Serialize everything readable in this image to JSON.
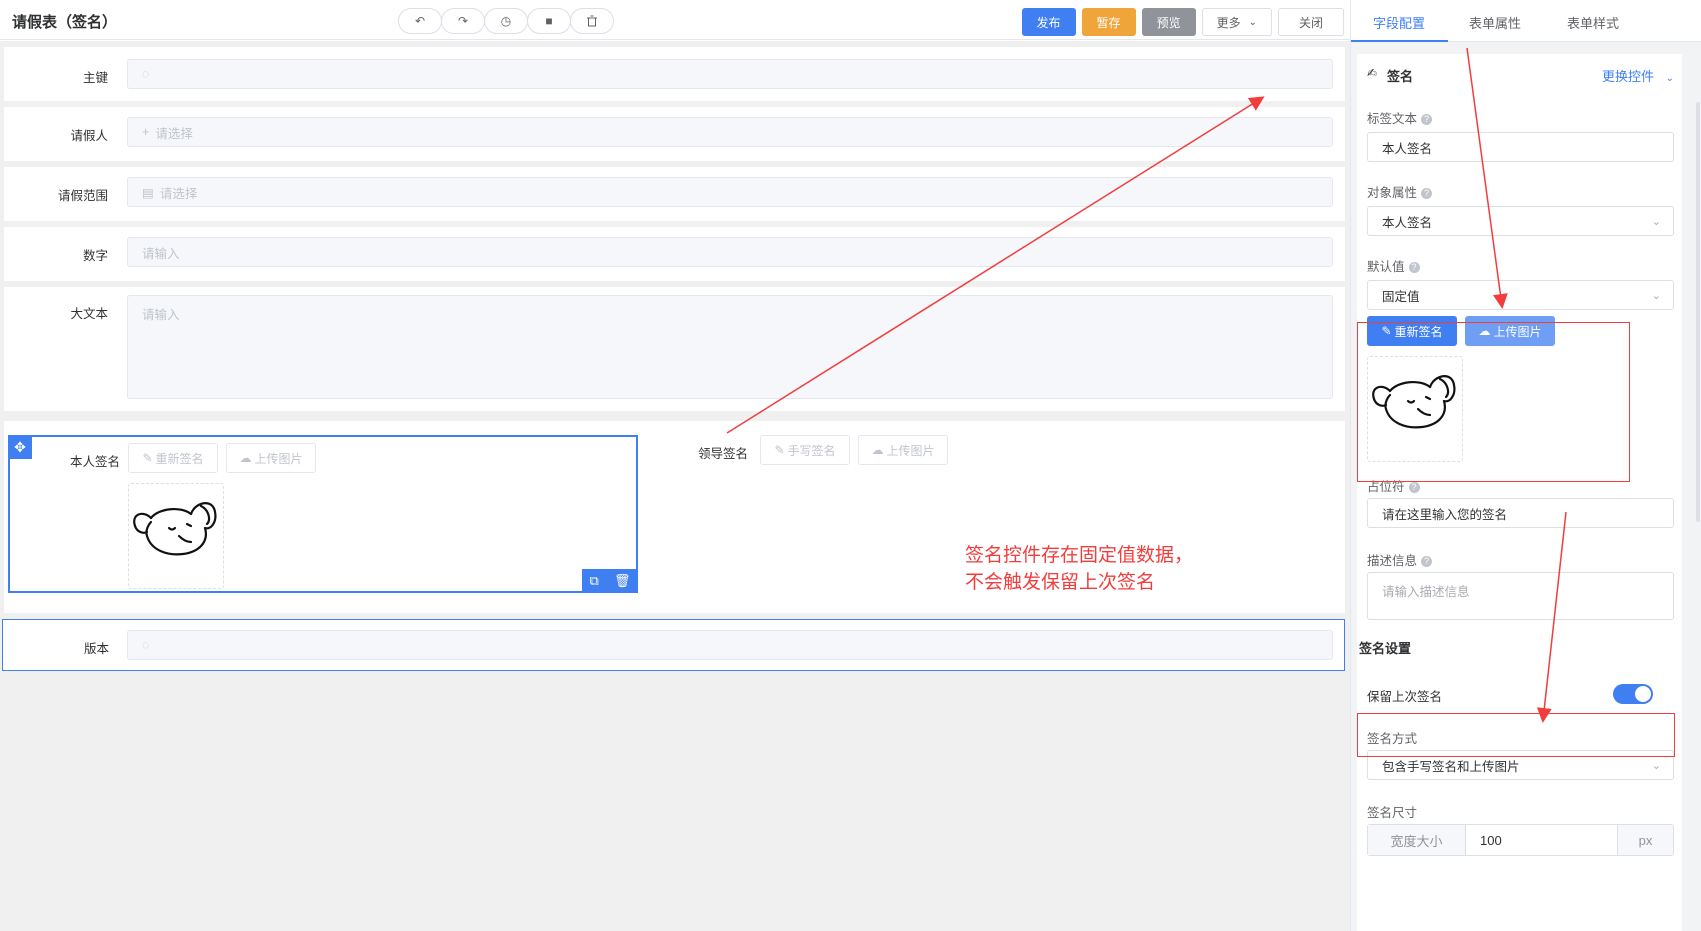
{
  "header": {
    "title": "请假表（签名）",
    "tools": [
      {
        "icon": "undo-icon",
        "glyph": "↶"
      },
      {
        "icon": "redo-icon",
        "glyph": "↷"
      },
      {
        "icon": "clock-icon",
        "glyph": "◷"
      },
      {
        "icon": "clear-icon",
        "glyph": "■"
      },
      {
        "icon": "trash-icon",
        "glyph": "🗑"
      }
    ],
    "publish": "发布",
    "save_draft": "暂存",
    "preview": "预览",
    "more": "更多",
    "close": "关闭"
  },
  "form": {
    "primary_key_label": "主键",
    "leave_person_label": "请假人",
    "leave_person_placeholder": "请选择",
    "leave_range_label": "请假范围",
    "leave_range_placeholder": "请选择",
    "number_label": "数字",
    "number_placeholder": "请输入",
    "bigtext_label": "大文本",
    "bigtext_placeholder": "请输入",
    "own_sign_label": "本人签名",
    "own_sign_resign": "重新签名",
    "own_sign_upload": "上传图片",
    "leader_sign_label": "领导签名",
    "leader_sign_hand": "手写签名",
    "leader_sign_upload": "上传图片",
    "version_label": "版本"
  },
  "annotation": {
    "line1": "签名控件存在固定值数据，",
    "line2": "不会触发保留上次签名"
  },
  "panel": {
    "tabs": [
      "字段配置",
      "表单属性",
      "表单样式"
    ],
    "ctrl_title": "签名",
    "ctrl_swap": "更换控件",
    "label_text_label": "标签文本",
    "label_text_value": "本人签名",
    "obj_attr_label": "对象属性",
    "obj_attr_value": "本人签名",
    "default_label": "默认值",
    "default_value": "固定值",
    "resign_btn": "重新签名",
    "upload_btn": "上传图片",
    "placeholder_label": "占位符",
    "placeholder_value": "请在这里输入您的签名",
    "desc_label": "描述信息",
    "desc_placeholder": "请输入描述信息",
    "sig_settings_title": "签名设置",
    "keep_last_label": "保留上次签名",
    "keep_last_on": true,
    "sign_mode_label": "签名方式",
    "sign_mode_value": "包含手写签名和上传图片",
    "sign_size_label": "签名尺寸",
    "width_prefix": "宽度大小",
    "width_value": "100",
    "width_unit": "px"
  },
  "colors": {
    "accent": "#3f7ff2",
    "orange": "#f0a53a",
    "annotation_red": "#f23d3d"
  }
}
